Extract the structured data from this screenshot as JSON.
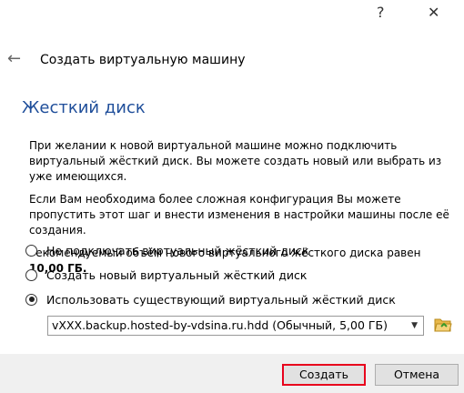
{
  "titlebar": {
    "help_label": "?",
    "close_label": "✕"
  },
  "header": {
    "title": "Создать виртуальную машину"
  },
  "page": {
    "title": "Жесткий диск"
  },
  "content": {
    "para1": "При желании к новой виртуальной машине можно подключить виртуальный жёсткий диск. Вы можете создать новый или выбрать из уже имеющихся.",
    "para2": "Если Вам необходима более сложная конфигурация Вы можете пропустить этот шаг и внести изменения в настройки машины после её создания.",
    "recommend_text": "Рекомендуемый объём нового виртуального жёсткого диска равен",
    "recommend_size": "10,00 ГБ."
  },
  "options": [
    {
      "label": "Не подключать виртуальный жёсткий диск",
      "checked": false
    },
    {
      "label": "Создать новый виртуальный жёсткий диск",
      "checked": false
    },
    {
      "label": "Использовать существующий виртуальный жёсткий диск",
      "checked": true
    }
  ],
  "disk_select": {
    "value": "vXXX.backup.hosted-by-vdsina.ru.hdd (Обычный, 5,00 ГБ)"
  },
  "buttons": {
    "create": "Создать",
    "cancel": "Отмена"
  }
}
